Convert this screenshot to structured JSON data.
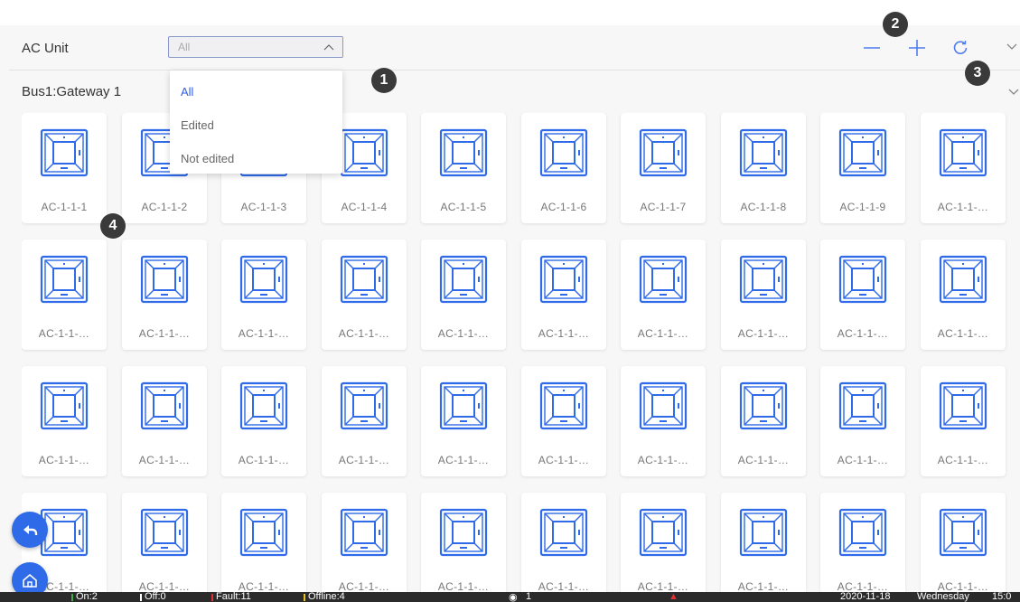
{
  "header": {
    "title": "AC Unit"
  },
  "filter": {
    "value": "All",
    "options": [
      {
        "label": "All",
        "selected": true
      },
      {
        "label": "Edited",
        "selected": false
      },
      {
        "label": "Not edited",
        "selected": false
      }
    ]
  },
  "toolbar": {
    "zoom_out_icon": "minus-icon",
    "zoom_in_icon": "plus-icon",
    "refresh_icon": "refresh-icon",
    "collapse_icon": "chevron-down-icon"
  },
  "gateway": {
    "title": "Bus1:Gateway 1"
  },
  "units": {
    "row1": [
      "AC-1-1-1",
      "AC-1-1-2",
      "AC-1-1-3",
      "AC-1-1-4",
      "AC-1-1-5",
      "AC-1-1-6",
      "AC-1-1-7",
      "AC-1-1-8",
      "AC-1-1-9",
      "AC-1-1-…"
    ],
    "row2": [
      "AC-1-1-…",
      "AC-1-1-…",
      "AC-1-1-…",
      "AC-1-1-…",
      "AC-1-1-…",
      "AC-1-1-…",
      "AC-1-1-…",
      "AC-1-1-…",
      "AC-1-1-…",
      "AC-1-1-…"
    ],
    "row3": [
      "AC-1-1-…",
      "AC-1-1-…",
      "AC-1-1-…",
      "AC-1-1-…",
      "AC-1-1-…",
      "AC-1-1-…",
      "AC-1-1-…",
      "AC-1-1-…",
      "AC-1-1-…",
      "AC-1-1-…"
    ],
    "row4": [
      "AC-1-1-…",
      "AC-1-1-…",
      "AC-1-1-…",
      "AC-1-1-…",
      "AC-1-1-…",
      "AC-1-1-…",
      "AC-1-1-…",
      "AC-1-1-…",
      "AC-1-1-…",
      "AC-1-1-…"
    ]
  },
  "markers": [
    "1",
    "2",
    "3",
    "4"
  ],
  "status": {
    "on": "On:2",
    "off": "Off:0",
    "fault": "Fault:11",
    "offline": "Offline:4",
    "users": "1",
    "date": "2020-11-18",
    "weekday": "Wednesday",
    "time": "15:0"
  },
  "colors": {
    "accent": "#2f6ae8",
    "selected_text": "#2f5ce8",
    "on": "#3cb043",
    "off": "#ffffff",
    "fault": "#e03030",
    "offline": "#f0c020"
  }
}
